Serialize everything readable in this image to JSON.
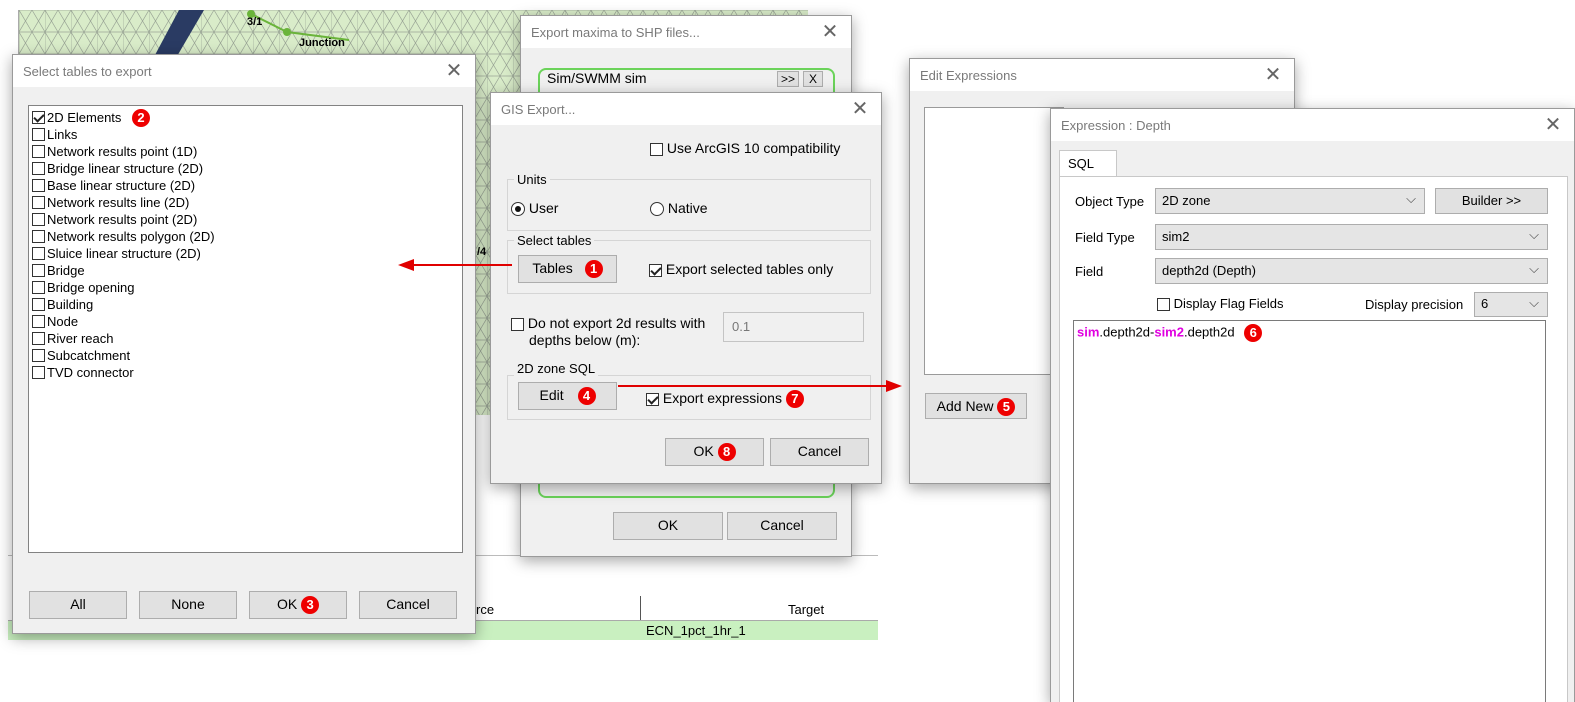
{
  "background": {
    "map_labels": {
      "node_label": "3/1",
      "junction_label": "Junction",
      "side_label": "/4"
    },
    "results_table": {
      "col_source": "rce",
      "col_target": "Target",
      "row_target": "ECN_1pct_1hr_1"
    }
  },
  "export_maxima_dialog": {
    "title": "Export maxima to SHP files...",
    "sim_label": "Sim/SWMM sim",
    "sim_btn_forward": ">>",
    "sim_btn_remove": "X",
    "ok_label": "OK",
    "cancel_label": "Cancel"
  },
  "select_tables_dialog": {
    "title": "Select tables to export",
    "items": [
      {
        "label": "2D Elements",
        "checked": true
      },
      {
        "label": "Links",
        "checked": false
      },
      {
        "label": "Network results point (1D)",
        "checked": false
      },
      {
        "label": "Bridge linear structure (2D)",
        "checked": false
      },
      {
        "label": "Base linear structure (2D)",
        "checked": false
      },
      {
        "label": "Network results line (2D)",
        "checked": false
      },
      {
        "label": "Network results point (2D)",
        "checked": false
      },
      {
        "label": "Network results polygon (2D)",
        "checked": false
      },
      {
        "label": "Sluice linear structure (2D)",
        "checked": false
      },
      {
        "label": "Bridge",
        "checked": false
      },
      {
        "label": "Bridge opening",
        "checked": false
      },
      {
        "label": "Building",
        "checked": false
      },
      {
        "label": "Node",
        "checked": false
      },
      {
        "label": "River reach",
        "checked": false
      },
      {
        "label": "Subcatchment",
        "checked": false
      },
      {
        "label": "TVD connector",
        "checked": false
      }
    ],
    "all_label": "All",
    "none_label": "None",
    "ok_label": "OK",
    "cancel_label": "Cancel",
    "badge_list": "2",
    "badge_ok": "3"
  },
  "gis_export_dialog": {
    "title": "GIS Export...",
    "arcgis_label": "Use ArcGIS 10 compatibility",
    "units_group": "Units",
    "unit_user": "User",
    "unit_native": "Native",
    "select_tables_group": "Select tables",
    "tables_btn": "Tables",
    "badge_tables": "1",
    "export_selected_label": "Export selected tables only",
    "no_export_label_line1": "Do not export 2d results with",
    "no_export_label_line2": "depths below (m):",
    "depth_value": "0.1",
    "zone_sql_group": "2D zone SQL",
    "edit_btn": "Edit",
    "badge_edit": "4",
    "export_expr_label": "Export expressions",
    "badge_expr": "7",
    "ok_label": "OK",
    "badge_ok": "8",
    "cancel_label": "Cancel"
  },
  "edit_expressions_dialog": {
    "title": "Edit Expressions",
    "add_new_label": "Add New",
    "badge_add": "5"
  },
  "expression_dialog": {
    "title": "Expression : Depth",
    "tab_sql": "SQL",
    "object_type_label": "Object Type",
    "object_type_value": "2D zone",
    "builder_btn": "Builder >>",
    "field_type_label": "Field Type",
    "field_type_value": "sim2",
    "field_label": "Field",
    "field_value": "depth2d  (Depth)",
    "display_flag_label": "Display Flag Fields",
    "display_precision_label": "Display precision",
    "display_precision_value": "6",
    "sql_part1": "sim",
    "sql_part2": ".depth2d-",
    "sql_part3": "sim2",
    "sql_part4": ".depth2d",
    "badge_sql": "6"
  },
  "colors": {
    "badge": "#e00000",
    "arrow": "#e00000",
    "keyword": "#e000e0",
    "green_border": "#6bd35a",
    "map_green": "#d7ecc4"
  }
}
